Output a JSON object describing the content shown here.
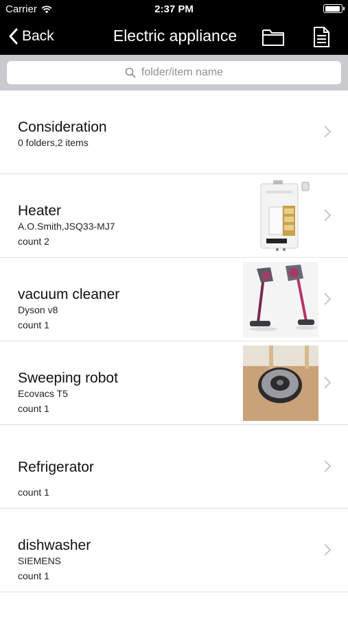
{
  "status": {
    "carrier": "Carrier",
    "time": "2:37 PM"
  },
  "nav": {
    "back_label": "Back",
    "title": "Electric appliance",
    "icons": [
      "folder-icon",
      "document-icon"
    ]
  },
  "search": {
    "placeholder": "folder/item name"
  },
  "items": [
    {
      "title": "Consideration",
      "subtitle": "0 folders,2 items",
      "count": "",
      "image": ""
    },
    {
      "title": "Heater",
      "subtitle": "A.O.Smith,JSQ33-MJ7",
      "count": "count 2",
      "image": "water-heater"
    },
    {
      "title": "vacuum cleaner",
      "subtitle": "Dyson v8",
      "count": "count 1",
      "image": "stick-vacuum"
    },
    {
      "title": "Sweeping robot",
      "subtitle": "Ecovacs T5",
      "count": "count 1",
      "image": "robot-vacuum"
    },
    {
      "title": "Refrigerator",
      "subtitle": "",
      "count": "count 1",
      "image": ""
    },
    {
      "title": "dishwasher",
      "subtitle": "SIEMENS",
      "count": "count 1",
      "image": ""
    }
  ]
}
